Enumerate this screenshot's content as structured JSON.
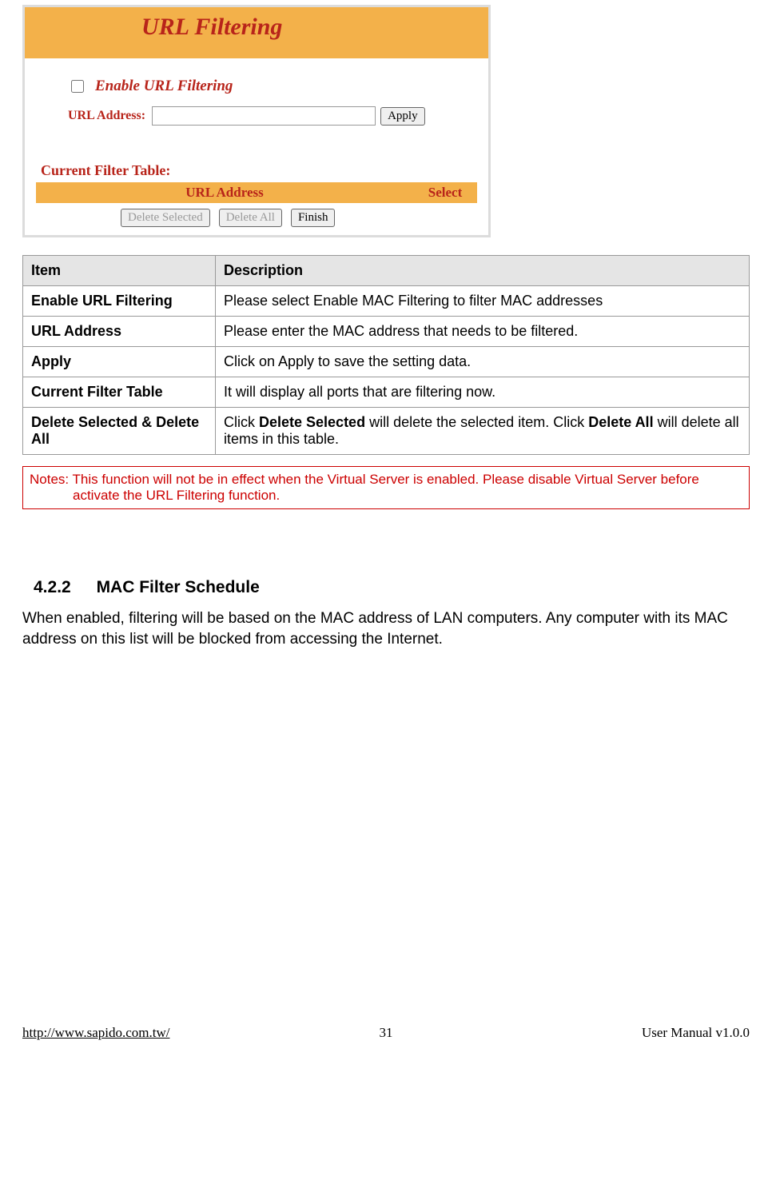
{
  "ui": {
    "title": "URL Filtering",
    "enable_label": "Enable URL Filtering",
    "url_address_label": "URL Address:",
    "apply_btn": "Apply",
    "cft_label": "Current Filter Table:",
    "col_url": "URL Address",
    "col_select": "Select",
    "btn_delete_selected": "Delete Selected",
    "btn_delete_all": "Delete All",
    "btn_finish": "Finish"
  },
  "desc_table": {
    "header_item": "Item",
    "header_desc": "Description",
    "rows": [
      {
        "item": "Enable URL Filtering",
        "desc": "Please select Enable MAC Filtering to filter MAC addresses"
      },
      {
        "item": "URL Address",
        "desc": "Please enter the MAC address that needs to be filtered."
      },
      {
        "item": "Apply",
        "desc": "Click on Apply to save the setting data."
      },
      {
        "item": "Current Filter Table",
        "desc": "It will display all ports that are filtering now."
      },
      {
        "item": "Delete Selected & Delete All",
        "desc_pre": "Click ",
        "desc_b1": "Delete Selected",
        "desc_mid": " will delete the selected item. Click ",
        "desc_b2": "Delete All",
        "desc_post": " will delete all items in this table."
      }
    ]
  },
  "notes": {
    "line1": "Notes: This function will not be in effect when the Virtual Server is enabled. Please disable Virtual Server before",
    "line2": "activate the URL Filtering function."
  },
  "section": {
    "number": "4.2.2",
    "title": "MAC Filter Schedule",
    "body": "When enabled, filtering will be based on the MAC address of LAN computers. Any computer with its MAC address on this list will be blocked from accessing the Internet."
  },
  "footer": {
    "url": "http://www.sapido.com.tw/",
    "page": "31",
    "version": "User Manual v1.0.0"
  }
}
